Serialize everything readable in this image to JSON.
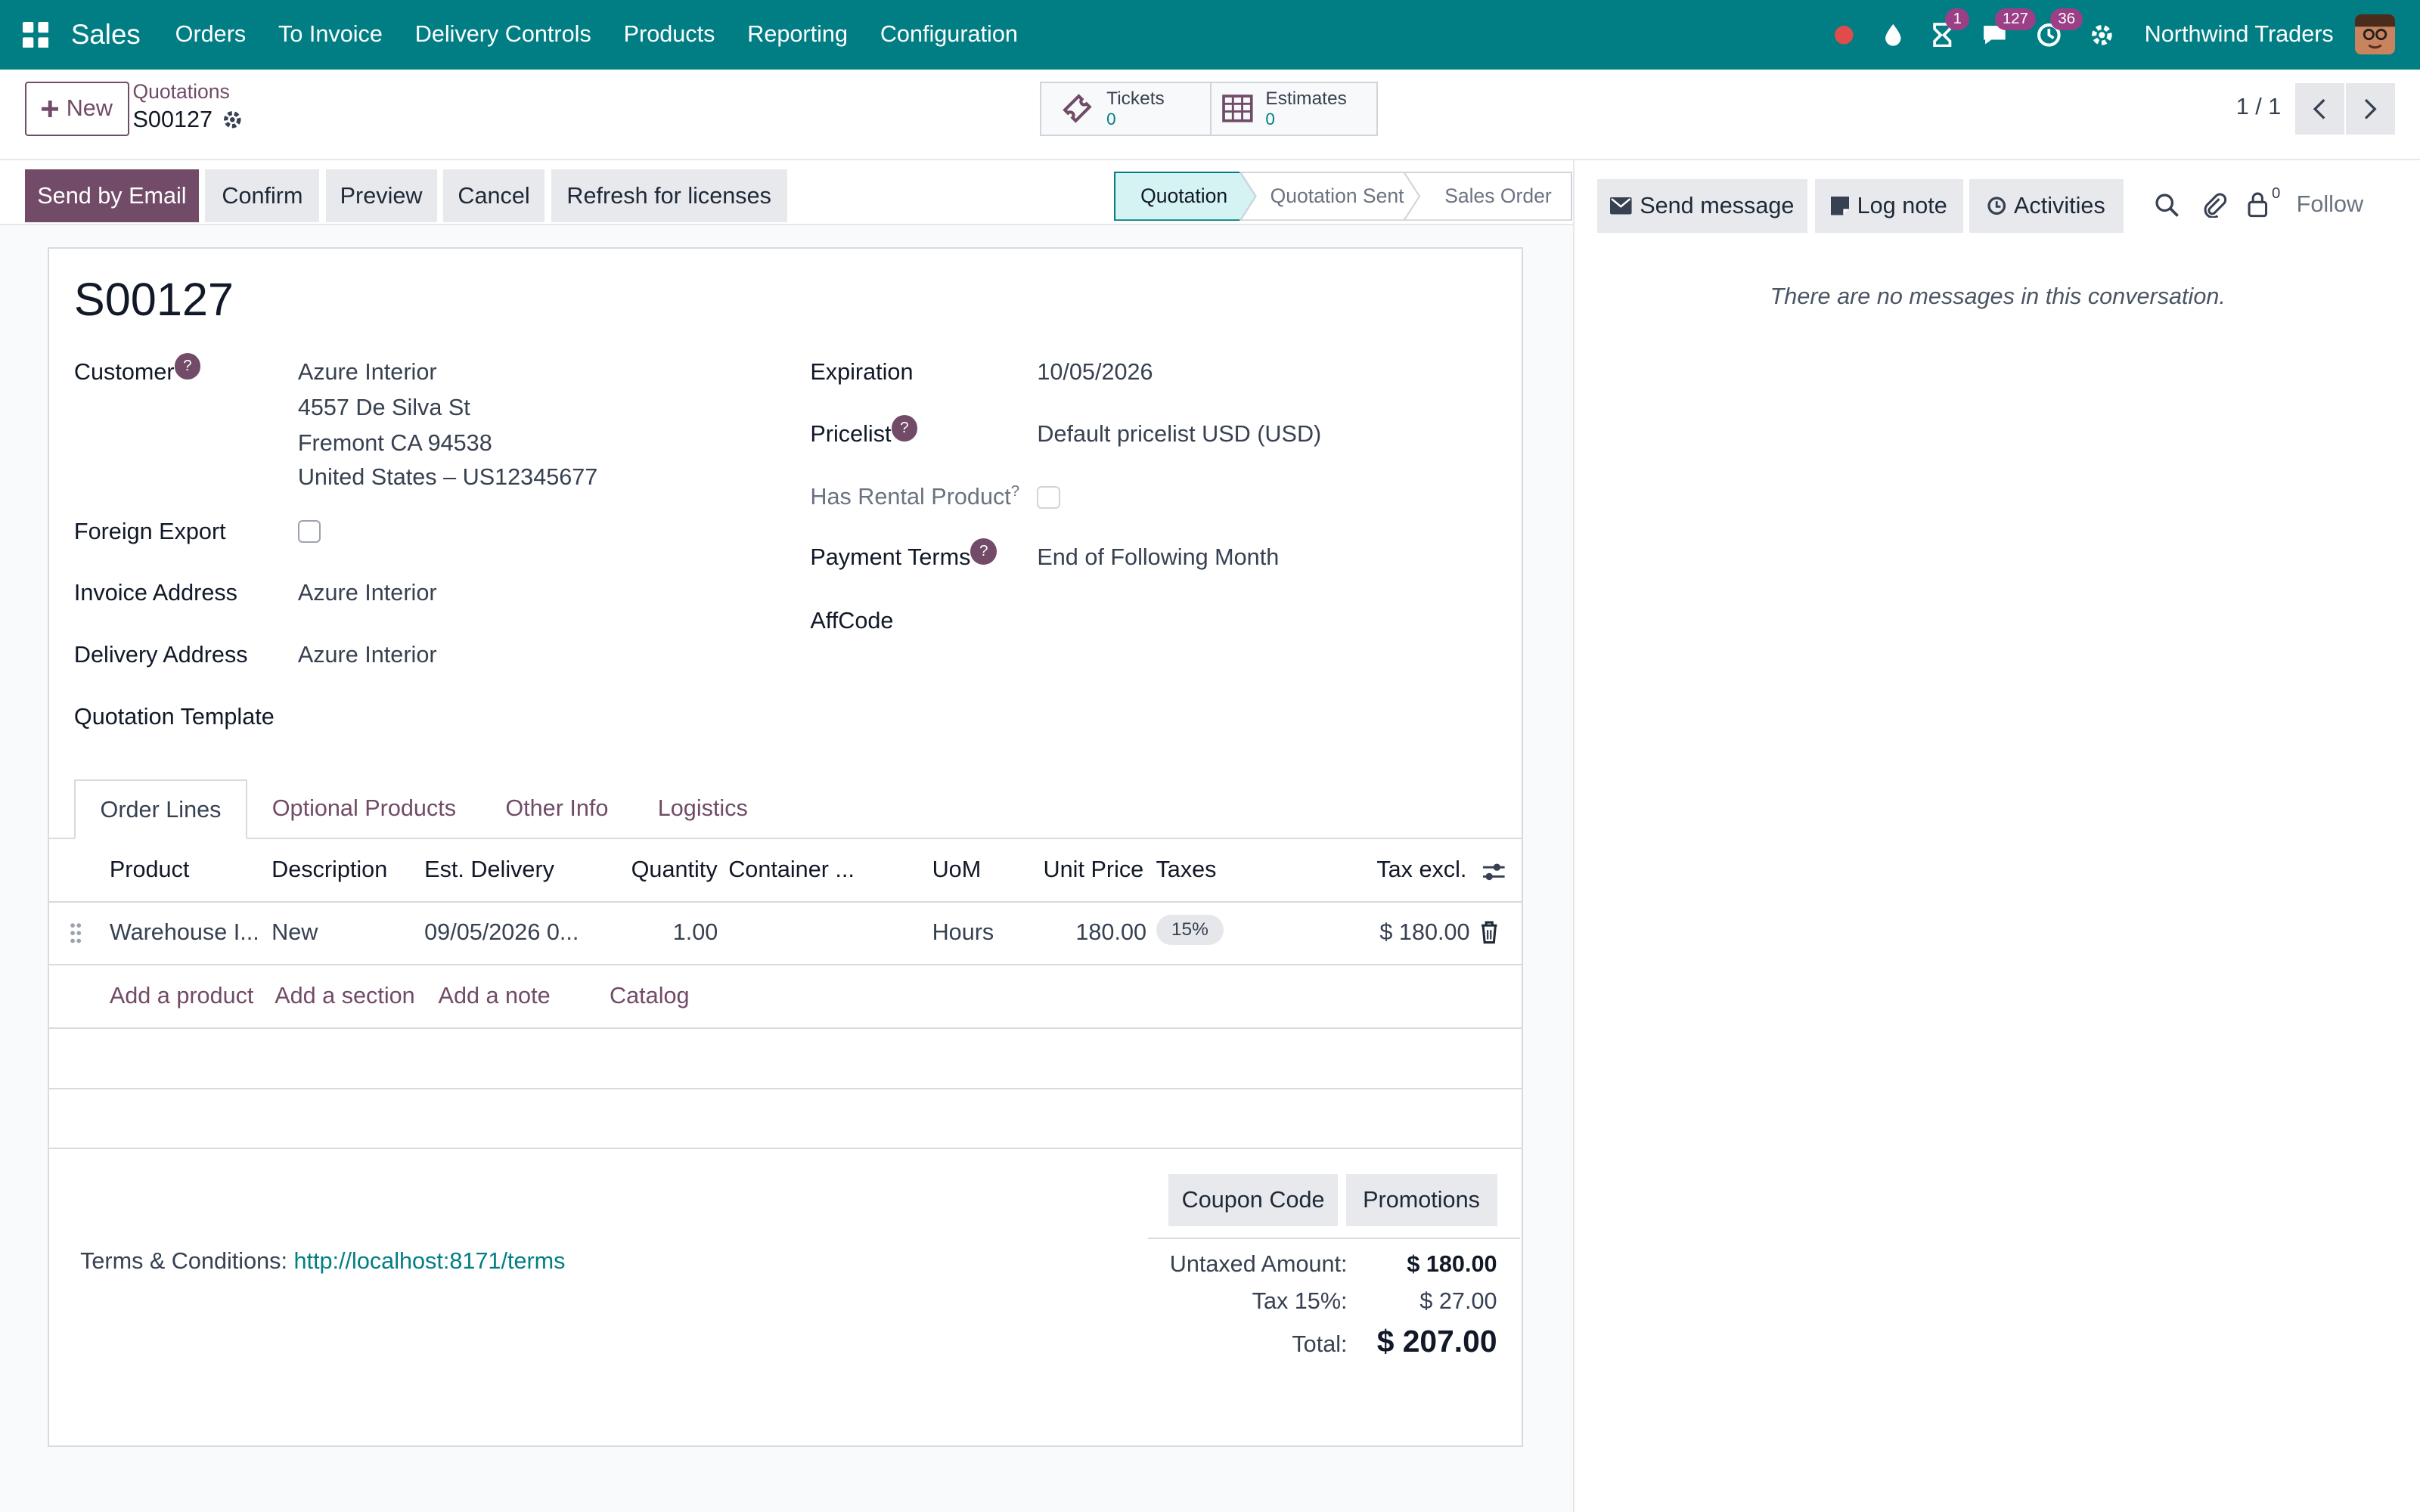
{
  "navbar": {
    "app_name": "Sales",
    "menu": [
      "Orders",
      "To Invoice",
      "Delivery Controls",
      "Products",
      "Reporting",
      "Configuration"
    ],
    "badges": {
      "activities": "1",
      "messages": "127",
      "clock": "36"
    },
    "company": "Northwind Traders"
  },
  "control_panel": {
    "new_label": "New",
    "breadcrumb_parent": "Quotations",
    "breadcrumb_current": "S00127",
    "stats": [
      {
        "label": "Tickets",
        "value": "0"
      },
      {
        "label": "Estimates",
        "value": "0"
      }
    ],
    "pager": "1 / 1"
  },
  "actions": [
    "Send by Email",
    "Confirm",
    "Preview",
    "Cancel",
    "Refresh for licenses"
  ],
  "stages": [
    "Quotation",
    "Quotation Sent",
    "Sales Order"
  ],
  "form": {
    "name": "S00127",
    "customer_label": "Customer",
    "customer_lines": [
      "Azure Interior",
      "4557 De Silva St",
      "Fremont CA 94538",
      "United States – US12345677"
    ],
    "foreign_export_label": "Foreign Export",
    "invoice_address_label": "Invoice Address",
    "invoice_address": "Azure Interior",
    "delivery_address_label": "Delivery Address",
    "delivery_address": "Azure Interior",
    "template_label": "Quotation Template",
    "expiration_label": "Expiration",
    "expiration": "10/05/2026",
    "pricelist_label": "Pricelist",
    "pricelist": "Default pricelist USD  (USD)",
    "rental_label": "Has Rental Product",
    "payment_terms_label": "Payment Terms",
    "payment_terms": "End of Following Month",
    "affcode_label": "AffCode",
    "help_mark": "?"
  },
  "tabs": [
    "Order Lines",
    "Optional Products",
    "Other Info",
    "Logistics"
  ],
  "table": {
    "headers": [
      "Product",
      "Description",
      "Est. Delivery",
      "Quantity",
      "Container ...",
      "UoM",
      "Unit Price",
      "Taxes",
      "Tax excl."
    ],
    "row": {
      "product": "Warehouse I...",
      "description": "New",
      "delivery": "09/05/2026 0...",
      "quantity": "1.00",
      "uom": "Hours",
      "unit_price": "180.00",
      "tax": "15%",
      "subtotal": "$ 180.00"
    },
    "add_links": [
      "Add a product",
      "Add a section",
      "Add a note",
      "Catalog"
    ]
  },
  "footer": {
    "coupon_label": "Coupon Code",
    "promotions_label": "Promotions",
    "terms_label": "Terms & Conditions:",
    "terms_link": "http://localhost:8171/terms",
    "untaxed_label": "Untaxed Amount:",
    "untaxed_value": "$ 180.00",
    "tax_label": "Tax 15%:",
    "tax_value": "$ 27.00",
    "total_label": "Total:",
    "total_value": "$ 207.00"
  },
  "chatter": {
    "send_message": "Send message",
    "log_note": "Log note",
    "activities": "Activities",
    "followers_count": "0",
    "follow": "Follow",
    "empty": "There are no messages in this conversation."
  },
  "colors": {
    "navbar": "#017e84",
    "primary": "#714b67",
    "link": "#017e84"
  }
}
